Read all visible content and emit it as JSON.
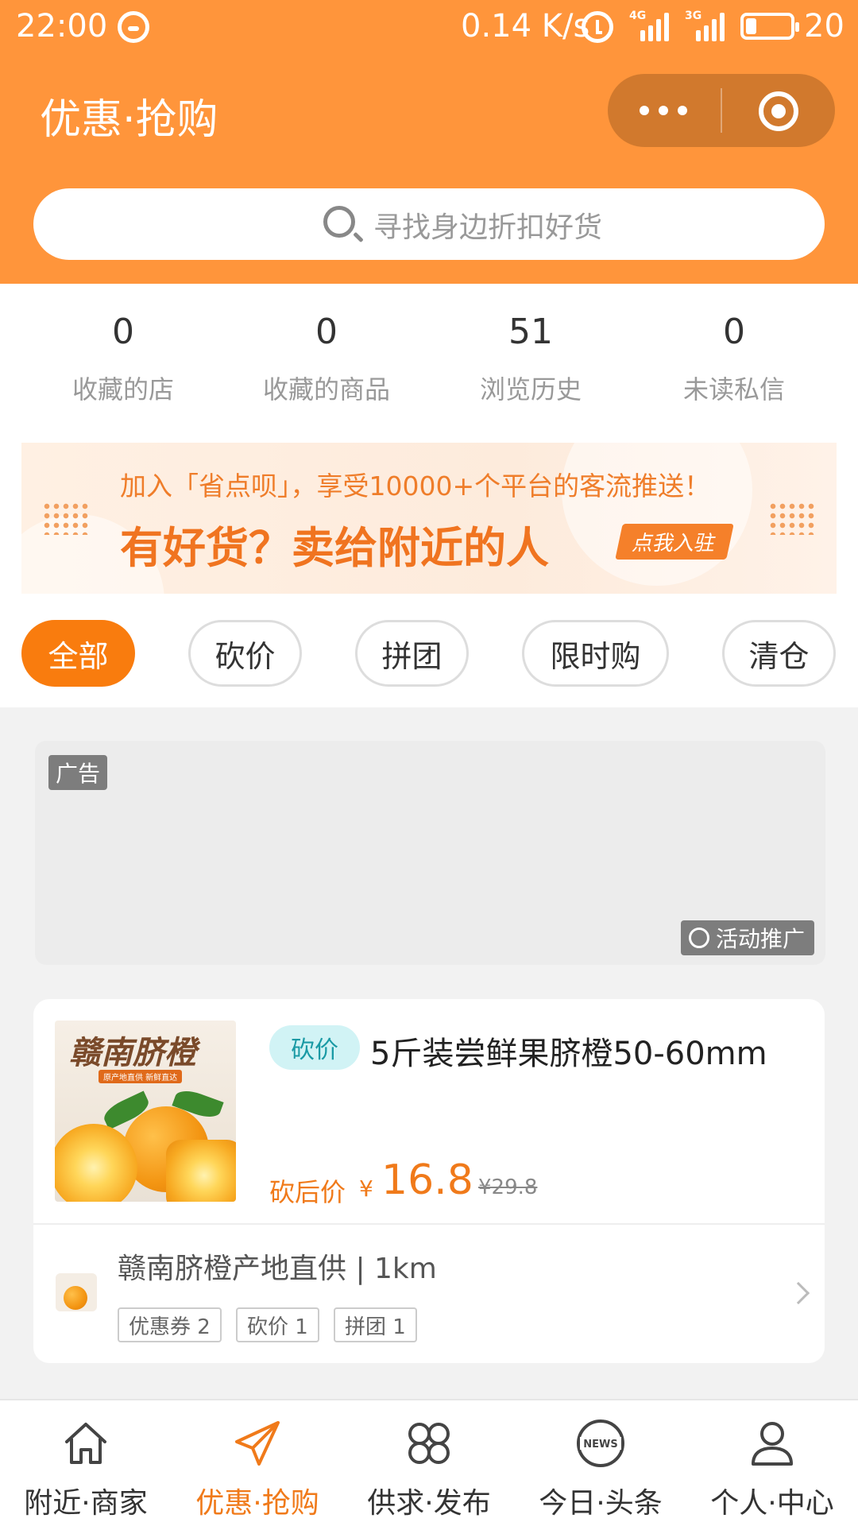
{
  "statusbar": {
    "time": "22:00",
    "speed": "0.14 K/s",
    "net1": "4G",
    "net2": "3G",
    "battery": "20"
  },
  "header": {
    "title": "优惠·抢购"
  },
  "search": {
    "placeholder": "寻找身边折扣好货"
  },
  "stats": [
    {
      "value": "0",
      "label": "收藏的店"
    },
    {
      "value": "0",
      "label": "收藏的商品"
    },
    {
      "value": "51",
      "label": "浏览历史"
    },
    {
      "value": "0",
      "label": "未读私信"
    }
  ],
  "banner": {
    "line1": "加入「省点呗」，享受10000+个平台的客流推送！",
    "line2": "有好货？卖给附近的人",
    "button": "点我入驻"
  },
  "tabs": [
    "全部",
    "砍价",
    "拼团",
    "限时购",
    "清仓"
  ],
  "active_tab": 0,
  "ad": {
    "badge": "广告",
    "promo": "活动推广"
  },
  "product": {
    "image_title": "赣南脐橙",
    "image_tag": "原产地直供 新鲜直达",
    "tag": "砍价",
    "name": "5斤装尝鲜果脐橙50-60mm",
    "price_label": "砍后价",
    "currency": "¥",
    "price": "16.8",
    "original_price": "¥29.8",
    "shop_name": "赣南脐橙产地直供 | 1km",
    "chips": [
      "优惠券 2",
      "砍价 1",
      "拼团 1"
    ]
  },
  "bottom_nav": [
    {
      "label": "附近·商家",
      "icon": "home-icon"
    },
    {
      "label": "优惠·抢购",
      "icon": "paper-plane-icon"
    },
    {
      "label": "供求·发布",
      "icon": "grid-icon"
    },
    {
      "label": "今日·头条",
      "icon": "news-icon"
    },
    {
      "label": "个人·中心",
      "icon": "person-icon"
    }
  ],
  "active_nav": 1,
  "colors": {
    "brand_orange": "#ff953b",
    "active_orange": "#f97c0e",
    "price_orange": "#f07a1a",
    "tag_teal": "#1a9aa5"
  }
}
